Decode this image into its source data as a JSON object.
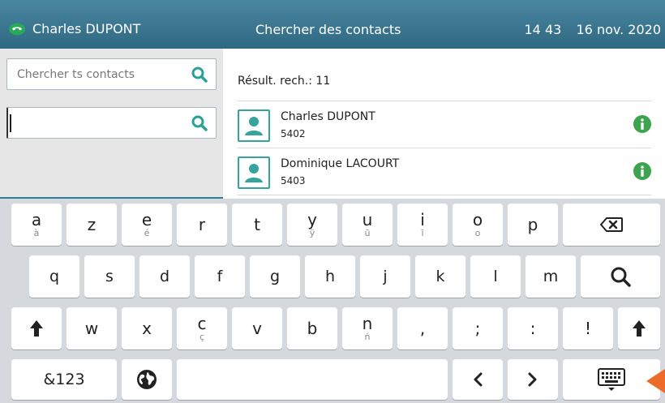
{
  "header": {
    "user_name": "Charles DUPONT",
    "title": "Chercher des contacts",
    "time": "14 43",
    "date": "16 nov. 2020",
    "phone_icon": "phone-icon"
  },
  "search": {
    "first_placeholder": "Chercher ts contacts",
    "second_value": ""
  },
  "results": {
    "count_label": "Résult. rech.: 11",
    "contacts": [
      {
        "name": "Charles DUPONT",
        "number": "5402"
      },
      {
        "name": "Dominique LACOURT",
        "number": "5403"
      }
    ]
  },
  "keyboard": {
    "row1": [
      {
        "k": "a",
        "s": "à"
      },
      {
        "k": "z",
        "s": ""
      },
      {
        "k": "e",
        "s": "é"
      },
      {
        "k": "r",
        "s": ""
      },
      {
        "k": "t",
        "s": ""
      },
      {
        "k": "y",
        "s": "ÿ"
      },
      {
        "k": "u",
        "s": "ū"
      },
      {
        "k": "i",
        "s": "ī"
      },
      {
        "k": "o",
        "s": "o"
      },
      {
        "k": "p",
        "s": ""
      }
    ],
    "row2": [
      "q",
      "s",
      "d",
      "f",
      "g",
      "h",
      "j",
      "k",
      "l",
      "m"
    ],
    "row3": [
      {
        "k": "w",
        "s": ""
      },
      {
        "k": "x",
        "s": ""
      },
      {
        "k": "c",
        "s": "ç"
      },
      {
        "k": "v",
        "s": ""
      },
      {
        "k": "b",
        "s": ""
      },
      {
        "k": "n",
        "s": "ń"
      },
      {
        "k": ",",
        "s": ""
      },
      {
        "k": ";",
        "s": ""
      },
      {
        "k": ":",
        "s": ""
      },
      {
        "k": "!",
        "s": ""
      }
    ],
    "numbers_label": "&123",
    "backspace_icon": "backspace-icon",
    "search_icon": "search-icon",
    "shift_icon": "shift-icon",
    "globe_icon": "globe-icon",
    "left_icon": "chevron-left-icon",
    "right_icon": "chevron-right-icon",
    "hide_icon": "keyboard-hide-icon"
  },
  "colors": {
    "header": "#3d7893",
    "accent": "#35a49c",
    "info": "#3ca34f",
    "arrow": "#ee6a2a"
  }
}
